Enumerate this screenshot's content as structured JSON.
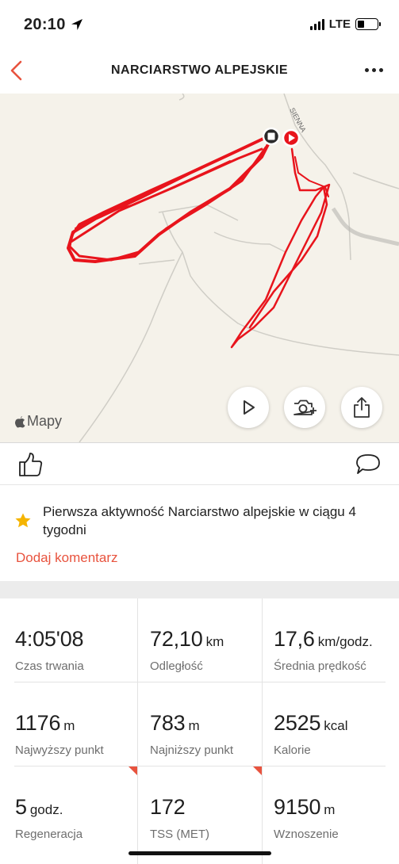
{
  "status_bar": {
    "time": "20:10",
    "network": "LTE",
    "battery_level": 0.35
  },
  "header": {
    "title": "NARCIARSTWO ALPEJSKIE",
    "back_icon": "chevron-left-icon",
    "more_icon": "more-dots-icon"
  },
  "map": {
    "logo_text": "Mapy",
    "street_label": "SIENNA",
    "route_color": "#e8141c",
    "buttons": [
      {
        "name": "play-route-button",
        "icon": "play-icon"
      },
      {
        "name": "add-photo-button",
        "icon": "camera-plus-icon"
      },
      {
        "name": "share-button",
        "icon": "share-icon"
      }
    ]
  },
  "actions": {
    "like_icon": "thumbs-up-icon",
    "comment_icon": "comment-bubble-icon"
  },
  "achievement": {
    "icon": "star-icon",
    "text": "Pierwsza aktywność Narciarstwo alpejskie w ciągu 4 tygodni",
    "add_comment": "Dodaj komentarz"
  },
  "stats": [
    {
      "value": "4:05'08",
      "unit": "",
      "label": "Czas trwania"
    },
    {
      "value": "72,10",
      "unit": "km",
      "label": "Odległość"
    },
    {
      "value": "17,6",
      "unit": "km/godz.",
      "label": "Średnia prędkość"
    },
    {
      "value": "1176",
      "unit": "m",
      "label": "Najwyższy punkt"
    },
    {
      "value": "783",
      "unit": "m",
      "label": "Najniższy punkt"
    },
    {
      "value": "2525",
      "unit": "kcal",
      "label": "Kalorie"
    },
    {
      "value": "5",
      "unit": "godz.",
      "label": "Regeneracja"
    },
    {
      "value": "172",
      "unit": "",
      "label": "TSS (MET)"
    },
    {
      "value": "9150",
      "unit": "m",
      "label": "Wznoszenie"
    }
  ],
  "colors": {
    "accent": "#e8533e",
    "route": "#e8141c",
    "map_bg": "#f5f2ea"
  }
}
